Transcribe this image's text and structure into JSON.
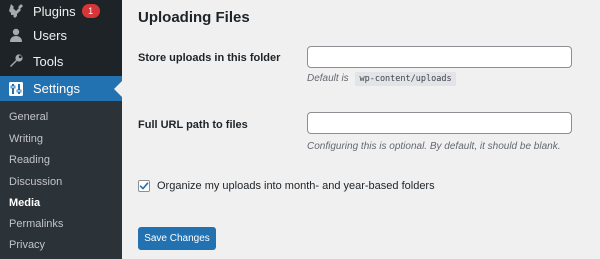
{
  "sidebar": {
    "menu": [
      {
        "label": "Plugins",
        "icon": "plugin-icon",
        "badge": "1"
      },
      {
        "label": "Users",
        "icon": "users-icon"
      },
      {
        "label": "Tools",
        "icon": "tools-icon"
      },
      {
        "label": "Settings",
        "icon": "settings-icon",
        "current": true
      }
    ],
    "submenu": [
      {
        "label": "General"
      },
      {
        "label": "Writing"
      },
      {
        "label": "Reading"
      },
      {
        "label": "Discussion"
      },
      {
        "label": "Media",
        "current": true
      },
      {
        "label": "Permalinks"
      },
      {
        "label": "Privacy"
      }
    ]
  },
  "main": {
    "section_title": "Uploading Files",
    "upload_path": {
      "label": "Store uploads in this folder",
      "value": "",
      "description_prefix": "Default is",
      "description_code": "wp-content/uploads"
    },
    "upload_url": {
      "label": "Full URL path to files",
      "value": "",
      "description": "Configuring this is optional. By default, it should be blank."
    },
    "organize_checkbox": {
      "label": "Organize my uploads into month- and year-based folders",
      "checked": true
    },
    "save_button": "Save Changes"
  },
  "colors": {
    "sidebar_bg": "#1d2327",
    "submenu_bg": "#2c3338",
    "accent": "#2271b1",
    "badge": "#d63638",
    "page_bg": "#f0f0f1"
  }
}
